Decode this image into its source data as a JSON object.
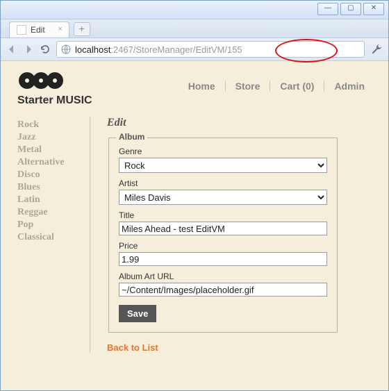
{
  "window": {
    "min": "—",
    "max": "▢",
    "close": "✕"
  },
  "tab": {
    "title": "Edit",
    "close": "×",
    "newtab": "+"
  },
  "addr": {
    "host": "localhost",
    "port_path": ":2467/StoreManager/EditVM/155"
  },
  "brand": "Starter MUSIC",
  "nav": [
    {
      "label": "Home"
    },
    {
      "label": "Store"
    },
    {
      "label": "Cart (0)"
    },
    {
      "label": "Admin"
    }
  ],
  "genres": [
    "Rock",
    "Jazz",
    "Metal",
    "Alternative",
    "Disco",
    "Blues",
    "Latin",
    "Reggae",
    "Pop",
    "Classical"
  ],
  "page_title": "Edit",
  "fieldset_legend": "Album",
  "form": {
    "genre_label": "Genre",
    "genre_value": "Rock",
    "artist_label": "Artist",
    "artist_value": "Miles Davis",
    "title_label": "Title",
    "title_value": "Miles Ahead - test EditVM",
    "price_label": "Price",
    "price_value": "1.99",
    "arturl_label": "Album Art URL",
    "arturl_value": "~/Content/Images/placeholder.gif",
    "save_label": "Save"
  },
  "back_link": "Back to List"
}
